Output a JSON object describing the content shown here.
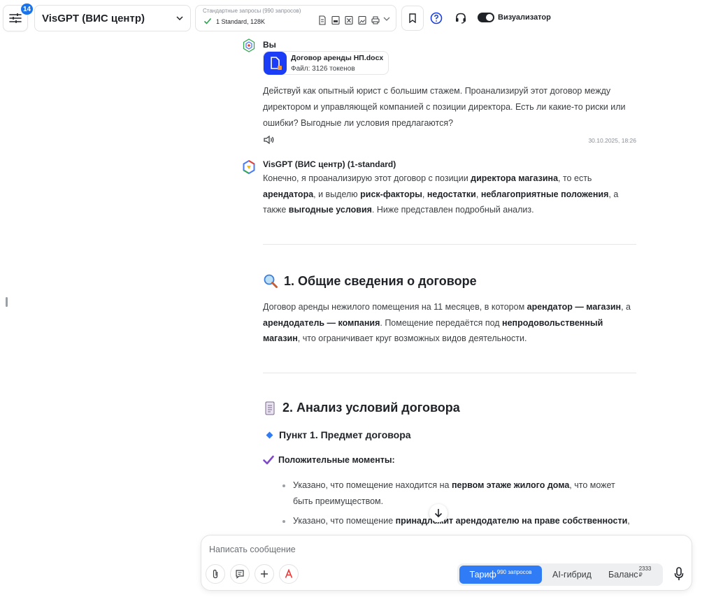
{
  "header": {
    "sidebar_badge": "14",
    "model_name": "VisGPT (ВИС центр)",
    "tier_caption": "Стандартные запросы (990 запросов)",
    "tier_value": "1 Standard, 128K",
    "visualizer_label": "Визуализатор"
  },
  "user_message": {
    "author": "Вы",
    "file_name": "Договор аренды НП.docx",
    "file_meta": "Файл: 3126 токенов",
    "text": "Действуй как опытный юрист с большим стажем. Проанализируй этот договор между директором и управляющей компанией с позиции директора. Есть ли какие-то риски или ошибки? Выгодные ли условия предлагаются?",
    "timestamp": "30.10.2025, 18:26"
  },
  "bot_message": {
    "author": "VisGPT (ВИС центр) (1-standard)",
    "intro": [
      {
        "t": "Конечно, я проанализирую этот договор с позиции ",
        "b": false
      },
      {
        "t": "директора магазина",
        "b": true
      },
      {
        "t": ", то есть ",
        "b": false
      },
      {
        "t": "арендатора",
        "b": true
      },
      {
        "t": ", и выделю ",
        "b": false
      },
      {
        "t": "риск-факторы",
        "b": true
      },
      {
        "t": ", ",
        "b": false
      },
      {
        "t": "недостатки",
        "b": true
      },
      {
        "t": ", ",
        "b": false
      },
      {
        "t": "неблагоприятные положения",
        "b": true
      },
      {
        "t": ", а также ",
        "b": false
      },
      {
        "t": "выгодные условия",
        "b": true
      },
      {
        "t": ". Ниже представлен подробный анализ.",
        "b": false
      }
    ],
    "section1_title": "1. Общие сведения о договоре",
    "section1_text": [
      {
        "t": "Договор аренды нежилого помещения на 11 месяцев, в котором ",
        "b": false
      },
      {
        "t": "арендатор — магазин",
        "b": true
      },
      {
        "t": ", а ",
        "b": false
      },
      {
        "t": "арендодатель — компания",
        "b": true
      },
      {
        "t": ". Помещение передаётся под ",
        "b": false
      },
      {
        "t": "непродовольственный магазин",
        "b": true
      },
      {
        "t": ", что ограничивает круг возможных видов деятельности.",
        "b": false
      }
    ],
    "section2_title": "2. Анализ условий договора",
    "subsection_title": "Пункт 1. Предмет договора",
    "positives_title": "Положительные моменты:",
    "bullet1": [
      {
        "t": "Указано, что помещение находится на ",
        "b": false
      },
      {
        "t": "первом этаже жилого дома",
        "b": true
      },
      {
        "t": ", что может быть преимуществом.",
        "b": false
      }
    ],
    "bullet2": [
      {
        "t": "Указано, что помещение ",
        "b": false
      },
      {
        "t": "принадлежит арендодателю на праве собственности",
        "b": true
      },
      {
        "t": ",",
        "b": false
      }
    ]
  },
  "composer": {
    "placeholder": "Написать сообщение",
    "mode_tariff": "Тариф",
    "mode_tariff_sup": "990 запросов",
    "mode_hybrid": "AI-гибрид",
    "mode_balance": "Баланс",
    "mode_balance_sup": "2333 ₽"
  },
  "icons": {
    "sidebar": "sliders-icon",
    "bookmark": "bookmark-icon",
    "help": "help-circle-icon",
    "support": "headset-icon",
    "speak": "speaker-icon",
    "attach": "paperclip-icon",
    "prompts": "message-template-icon",
    "add": "plus-icon",
    "text": "text-style-icon",
    "mic": "microphone-icon",
    "scroll": "arrow-down-icon"
  },
  "colors": {
    "accent": "#2f7cf6",
    "badge": "#1a73e8",
    "file_icon": "#1b3df5"
  }
}
